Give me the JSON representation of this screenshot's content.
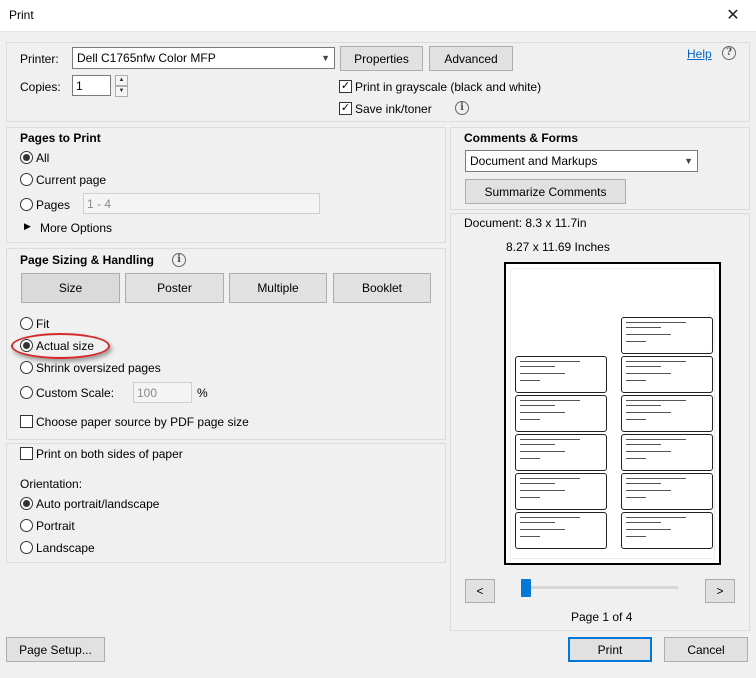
{
  "window": {
    "title": "Print",
    "close_glyph": "✕"
  },
  "printer": {
    "printer_label": "Printer:",
    "printer_value": "Dell C1765nfw Color MFP",
    "copies_label": "Copies:",
    "copies_value": "1",
    "properties_btn": "Properties",
    "advanced_btn": "Advanced",
    "help_link": "Help",
    "grayscale_label": "Print in grayscale (black and white)",
    "grayscale_checked": true,
    "save_ink_label": "Save ink/toner",
    "save_ink_checked": true
  },
  "pages_to_print": {
    "heading": "Pages to Print",
    "all_label": "All",
    "current_label": "Current page",
    "pages_label": "Pages",
    "pages_value": "1 - 4",
    "more_options_label": "More Options",
    "selected": "All"
  },
  "sizing": {
    "heading": "Page Sizing & Handling",
    "size_btn": "Size",
    "poster_btn": "Poster",
    "multiple_btn": "Multiple",
    "booklet_btn": "Booklet",
    "fit_label": "Fit",
    "actual_label": "Actual size",
    "shrink_label": "Shrink oversized pages",
    "custom_label": "Custom Scale:",
    "custom_value": "100",
    "percent": "%",
    "paper_source_label": "Choose paper source by PDF page size",
    "selected": "Actual size"
  },
  "duplex": {
    "both_sides_label": "Print on both sides of paper",
    "orientation_label": "Orientation:",
    "auto_label": "Auto portrait/landscape",
    "portrait_label": "Portrait",
    "landscape_label": "Landscape",
    "selected": "Auto portrait/landscape"
  },
  "comments": {
    "heading": "Comments & Forms",
    "value": "Document and Markups",
    "summarize_btn": "Summarize Comments"
  },
  "preview": {
    "document_size": "Document: 8.3 x 11.7in",
    "paper_size": "8.27 x 11.69 Inches",
    "prev_btn": "<",
    "next_btn": ">",
    "page_indicator": "Page 1 of 4",
    "slider_position_fraction": 0
  },
  "footer": {
    "page_setup_btn": "Page Setup...",
    "print_btn": "Print",
    "cancel_btn": "Cancel"
  },
  "colors": {
    "accent": "#0078d7",
    "link": "#0563c1",
    "highlight": "#d42a2a"
  },
  "icons": [
    "close-icon",
    "info-icon",
    "dropdown-arrow-icon",
    "expand-triangle-icon"
  ]
}
